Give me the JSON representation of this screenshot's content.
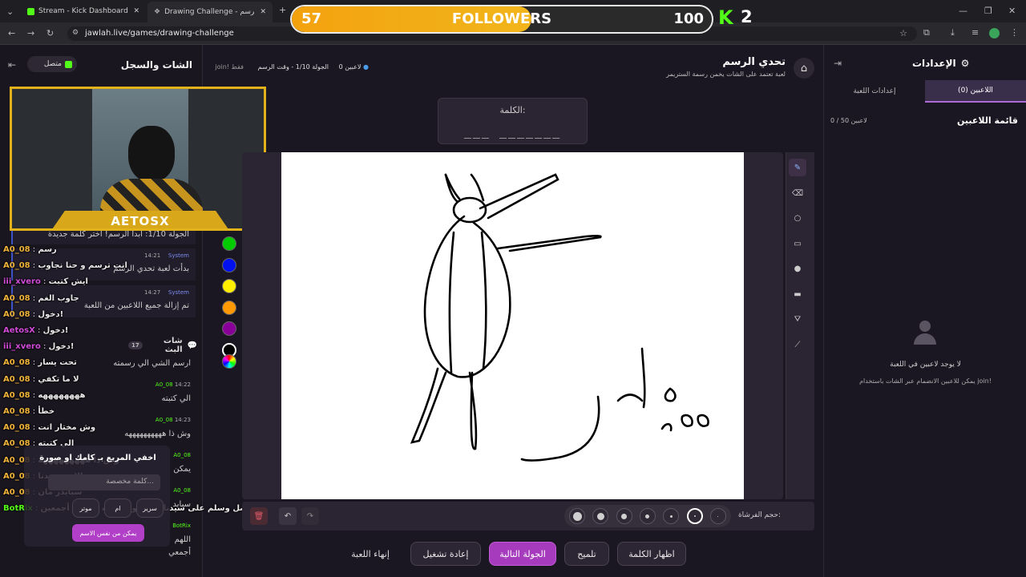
{
  "browser": {
    "tabs": [
      {
        "title": "Stream - Kick Dashboard"
      },
      {
        "title": "Drawing Challenge - تحدي الرسم"
      }
    ],
    "url": "jawlah.live/games/drawing-challenge"
  },
  "overlay": {
    "followers_current": "57",
    "followers_label": "FOLLOWERS",
    "followers_goal": "100",
    "followers_progress": 0.57,
    "kick_count": "2",
    "streamer_name": "AETOSX"
  },
  "left_panel": {
    "title": "الشات والسجل",
    "status": "متصل",
    "system_messages": [
      {
        "text": "الجولة 1/10: ابدأ الرسم! اختر كلمة جديدة"
      },
      {
        "author": "System",
        "time": "14:21",
        "text": "بدأت لعبة تحدي الرسم"
      },
      {
        "author": "System",
        "time": "14:27",
        "text": "تم إزالة جميع اللاعبين من اللعبة"
      }
    ],
    "chat_header": "شات البث",
    "chat_count": "17",
    "chat_messages": [
      {
        "user": "A0_08",
        "text": "رسم"
      },
      {
        "user": "A0_08",
        "text": "انت ترسم و حنا نجاوب"
      },
      {
        "user": "iii_xvero",
        "text": "ايش كتبت"
      },
      {
        "user": "A0_08",
        "text": "جاوب الغم"
      },
      {
        "user": "A0_08",
        "text": "دخول!"
      },
      {
        "user": "AetosX",
        "text": "دخول!"
      },
      {
        "user": "iii_xvero",
        "text": "دخول!"
      },
      {
        "user": "A0_08",
        "text": "تحت يسار"
      },
      {
        "user": "A0_08",
        "text": "لا ما تكفي"
      },
      {
        "user": "A0_08",
        "text": "ههههههههه"
      },
      {
        "user": "A0_08",
        "text": "خطأ"
      },
      {
        "user": "A0_08",
        "text": "وش مختار انت"
      },
      {
        "user": "A0_08",
        "text": "الي كتبته"
      },
      {
        "user": "A0_08",
        "text": "وش ذا هههههههههه"
      },
      {
        "user": "A0_08",
        "text": "الاسم عندنا"
      },
      {
        "user": "A0_08",
        "text": "سبايدر مان"
      },
      {
        "user": "BotRix",
        "text": "اللهم صل وسلم على سيدنا محمد وعلى آله وصحبه أجمعين"
      }
    ],
    "inner_chat": [
      {
        "text": "ارسم الشي الي رسمته"
      },
      {
        "user": "A0_08",
        "time": "14:22",
        "text": "الي كتبته"
      },
      {
        "user": "A0_08",
        "time": "14:23",
        "text": "وش ذا ههههههههههه"
      },
      {
        "user": "A0_08",
        "text": "يمكن"
      },
      {
        "user": "A0_08",
        "text": "سبايد"
      },
      {
        "user": "BotRix",
        "text": "اللهم"
      },
      {
        "text": "أجمعي"
      }
    ],
    "popup": {
      "title": "اخفي المربع بـ كامك او صورة",
      "custom_word": "كلمة مخصصة...",
      "choices": [
        "سرير",
        "ام",
        "موتر"
      ],
      "action": "يمكن من نفس الاسم"
    }
  },
  "game": {
    "title": "تحدي الرسم",
    "subtitle": "لعبة تعتمد على الشات يخمن رسمة الستريمر",
    "players": "0 لاعبين",
    "round_info": "الجولة 1/10 - وقت الرسم",
    "join_hint": "join! فقط",
    "word_label": "الكلمة:",
    "word_mask": "___ _______",
    "brush_size_label": "حجم الفرشاة:",
    "actions": {
      "reveal": "اظهار الكلمة",
      "hint": "تلميح",
      "next_round": "الجولة التالية",
      "restart": "إعادة تشغيل",
      "end": "إنهاء اللعبة"
    },
    "palette": [
      "#00cc00",
      "#0011ee",
      "#ffee00",
      "#ff9900",
      "#880099",
      "#000000"
    ]
  },
  "settings": {
    "title": "الإعدادات",
    "tabs": [
      "اللاعبين (0)",
      "إعدادات اللعبة"
    ],
    "list_title": "قائمة اللاعبين",
    "list_count": "0 / 50 لاعبين",
    "empty_title": "لا يوجد لاعبين في اللعبة",
    "empty_hint": "يمكن للاعبين الانضمام عبر الشات باستخدام join!"
  }
}
